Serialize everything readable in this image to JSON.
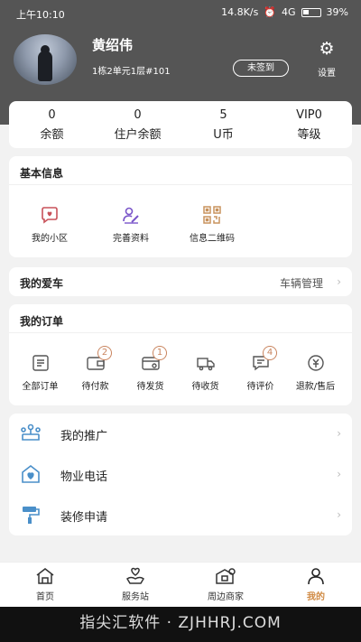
{
  "status_bar": {
    "time": "上午10:10",
    "speed": "14.8K/s",
    "network": "4G",
    "battery": "39%"
  },
  "profile": {
    "name": "黄绍伟",
    "address": "1栋2单元1层#101",
    "signin_label": "未签到",
    "settings_label": "设置"
  },
  "stats": [
    {
      "value": "0",
      "label": "余额"
    },
    {
      "value": "0",
      "label": "住户余额"
    },
    {
      "value": "5",
      "label": "U币"
    },
    {
      "value": "VIP0",
      "label": "等级"
    }
  ],
  "basic_info": {
    "title": "基本信息",
    "items": [
      {
        "label": "我的小区",
        "icon": "community-icon"
      },
      {
        "label": "完善资料",
        "icon": "profile-edit-icon"
      },
      {
        "label": "信息二维码",
        "icon": "qr-code-icon"
      }
    ]
  },
  "car": {
    "title": "我的爱车",
    "manage_label": "车辆管理"
  },
  "orders": {
    "title": "我的订单",
    "items": [
      {
        "label": "全部订单",
        "badge": "",
        "icon": "order-list-icon"
      },
      {
        "label": "待付款",
        "badge": "2",
        "icon": "wallet-icon"
      },
      {
        "label": "待发货",
        "badge": "1",
        "icon": "package-icon"
      },
      {
        "label": "待收货",
        "badge": "",
        "icon": "truck-icon"
      },
      {
        "label": "待评价",
        "badge": "4",
        "icon": "comment-icon"
      },
      {
        "label": "退款/售后",
        "badge": "",
        "icon": "refund-icon"
      }
    ]
  },
  "menu": [
    {
      "label": "我的推广",
      "icon": "promotion-icon"
    },
    {
      "label": "物业电话",
      "icon": "house-phone-icon"
    },
    {
      "label": "装修申请",
      "icon": "paint-roller-icon"
    }
  ],
  "tabs": [
    {
      "label": "首页",
      "icon": "home-icon"
    },
    {
      "label": "服务站",
      "icon": "service-icon"
    },
    {
      "label": "周边商家",
      "icon": "store-icon"
    },
    {
      "label": "我的",
      "icon": "person-icon"
    }
  ],
  "watermark": "指尖汇软件 · ZJHHRJ.COM",
  "colors": {
    "header_bg": "#555555",
    "accent": "#d08a43",
    "icon_blue": "#4a8fc9",
    "icon_red": "#c8525a",
    "icon_purple": "#7a55c9",
    "icon_orange": "#c9845e"
  }
}
